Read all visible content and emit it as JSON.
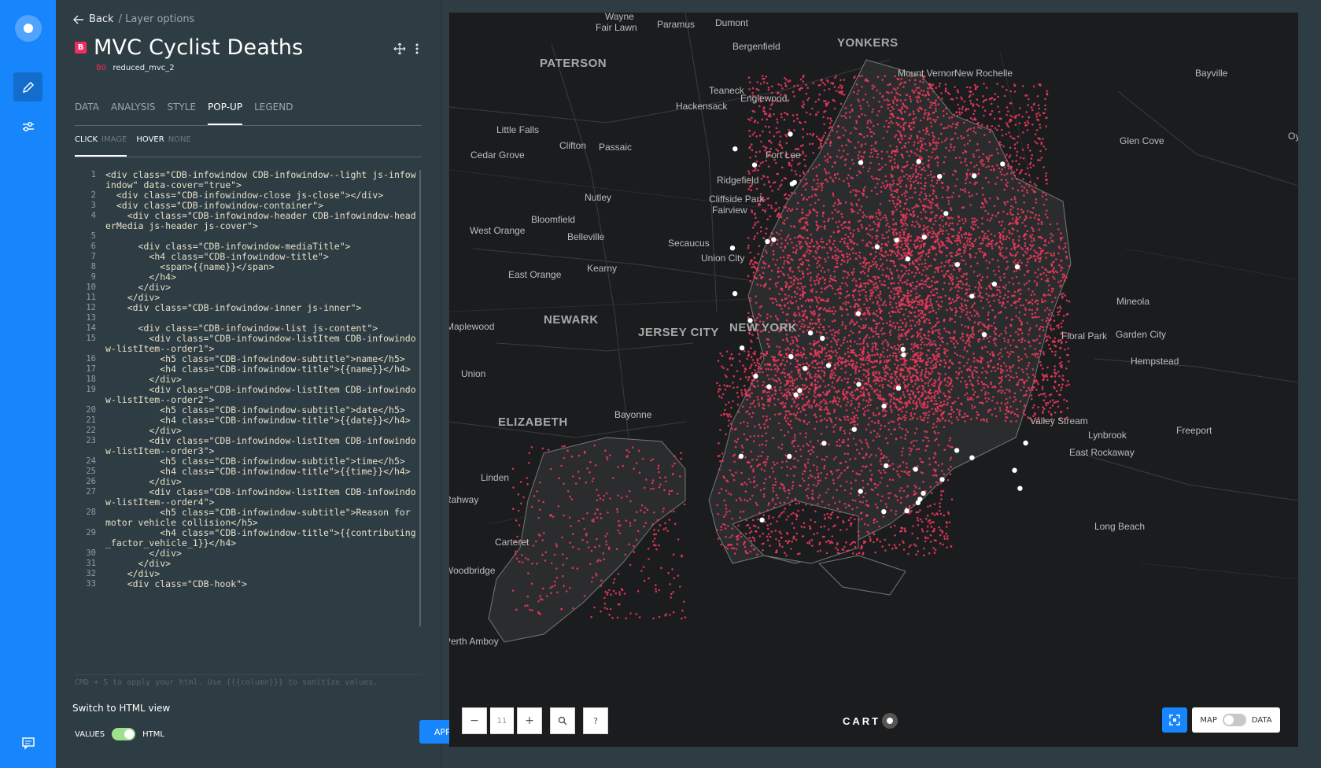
{
  "nav": {
    "icons": [
      "carto-logo-icon",
      "pencil-icon",
      "sliders-icon",
      "chat-icon"
    ]
  },
  "header": {
    "back_label": "Back",
    "crumb": "/ Layer options",
    "layer_badge": "B",
    "layer_title": "MVC Cyclist Deaths",
    "source_badge": "B0",
    "source_name": "reduced_mvc_2"
  },
  "tabs": [
    {
      "label": "DATA"
    },
    {
      "label": "ANALYSIS"
    },
    {
      "label": "STYLE"
    },
    {
      "label": "POP-UP",
      "active": true
    },
    {
      "label": "LEGEND"
    }
  ],
  "subtabs": [
    {
      "label": "CLICK",
      "value": "IMAGE",
      "active": true
    },
    {
      "label": "HOVER",
      "value": "NONE"
    }
  ],
  "editor": {
    "lines": [
      {
        "n": "1",
        "text": "<div class=\"CDB-infowindow CDB-infowindow--light js-infowindow\" data-cover=\"true\">"
      },
      {
        "n": "2",
        "text": "  <div class=\"CDB-infowindow-close js-close\"></div>"
      },
      {
        "n": "3",
        "text": "  <div class=\"CDB-infowindow-container\">"
      },
      {
        "n": "4",
        "text": "    <div class=\"CDB-infowindow-header CDB-infowindow-headerMedia js-header js-cover\">"
      },
      {
        "n": "5",
        "text": ""
      },
      {
        "n": "6",
        "text": "      <div class=\"CDB-infowindow-mediaTitle\">"
      },
      {
        "n": "7",
        "text": "        <h4 class=\"CDB-infowindow-title\">"
      },
      {
        "n": "8",
        "text": "          <span>{{name}}</span>"
      },
      {
        "n": "9",
        "text": "        </h4>"
      },
      {
        "n": "10",
        "text": "      </div>"
      },
      {
        "n": "11",
        "text": "    </div>"
      },
      {
        "n": "12",
        "text": "    <div class=\"CDB-infowindow-inner js-inner\">"
      },
      {
        "n": "13",
        "text": ""
      },
      {
        "n": "14",
        "text": "      <div class=\"CDB-infowindow-list js-content\">"
      },
      {
        "n": "15",
        "text": "        <div class=\"CDB-infowindow-listItem CDB-infowindow-listItem--order1\">"
      },
      {
        "n": "16",
        "text": "          <h5 class=\"CDB-infowindow-subtitle\">name</h5>"
      },
      {
        "n": "17",
        "text": "          <h4 class=\"CDB-infowindow-title\">{{name}}</h4>"
      },
      {
        "n": "18",
        "text": "        </div>"
      },
      {
        "n": "19",
        "text": "        <div class=\"CDB-infowindow-listItem CDB-infowindow-listItem--order2\">"
      },
      {
        "n": "20",
        "text": "          <h5 class=\"CDB-infowindow-subtitle\">date</h5>"
      },
      {
        "n": "21",
        "text": "          <h4 class=\"CDB-infowindow-title\">{{date}}</h4>"
      },
      {
        "n": "22",
        "text": "        </div>"
      },
      {
        "n": "23",
        "text": "        <div class=\"CDB-infowindow-listItem CDB-infowindow-listItem--order3\">"
      },
      {
        "n": "24",
        "text": "          <h5 class=\"CDB-infowindow-subtitle\">time</h5>"
      },
      {
        "n": "25",
        "text": "          <h4 class=\"CDB-infowindow-title\">{{time}}</h4>"
      },
      {
        "n": "26",
        "text": "        </div>"
      },
      {
        "n": "27",
        "text": "        <div class=\"CDB-infowindow-listItem CDB-infowindow-listItem--order4\">"
      },
      {
        "n": "28",
        "text": "          <h5 class=\"CDB-infowindow-subtitle\">Reason for motor vehicle collision</h5>"
      },
      {
        "n": "29",
        "text": "          <h4 class=\"CDB-infowindow-title\">{{contributing_factor_vehicle_1}}</h4>"
      },
      {
        "n": "30",
        "text": "        </div>"
      },
      {
        "n": "31",
        "text": "      </div>"
      },
      {
        "n": "32",
        "text": "    </div>"
      },
      {
        "n": "33",
        "text": "    <div class=\"CDB-hook\">"
      }
    ],
    "hint": "CMD + S to apply your html. Use {{{column}}} to sanitize values."
  },
  "footer": {
    "switch_label": "Switch to HTML view",
    "values_label": "VALUES",
    "html_label": "HTML",
    "apply_label": "APPLY"
  },
  "map": {
    "labels": [
      {
        "text": "Wayne"
      },
      {
        "text": "Fair Lawn"
      },
      {
        "text": "Paramus"
      },
      {
        "text": "Dumont"
      },
      {
        "text": "Bergenfield"
      },
      {
        "text": "YONKERS"
      },
      {
        "text": "Mount Vernon"
      },
      {
        "text": "New Rochelle"
      },
      {
        "text": "Bayville"
      },
      {
        "text": "PATERSON"
      },
      {
        "text": "Teaneck"
      },
      {
        "text": "Englewood"
      },
      {
        "text": "Hackensack"
      },
      {
        "text": "Little Falls"
      },
      {
        "text": "Clifton"
      },
      {
        "text": "Passaic"
      },
      {
        "text": "Cedar Grove"
      },
      {
        "text": "Fort Lee"
      },
      {
        "text": "Glen Cove"
      },
      {
        "text": "Ridgefield"
      },
      {
        "text": "Nutley"
      },
      {
        "text": "Cliffside Park"
      },
      {
        "text": "Fairview"
      },
      {
        "text": "Bloomfield"
      },
      {
        "text": "West Orange"
      },
      {
        "text": "Belleville"
      },
      {
        "text": "Secaucus"
      },
      {
        "text": "Union City"
      },
      {
        "text": "East Orange"
      },
      {
        "text": "Kearny"
      },
      {
        "text": "Mineola"
      },
      {
        "text": "NEWARK"
      },
      {
        "text": "JERSEY CITY"
      },
      {
        "text": "NEW YORK"
      },
      {
        "text": "Garden City"
      },
      {
        "text": "Floral Park"
      },
      {
        "text": "Maplewood"
      },
      {
        "text": "Hempstead"
      },
      {
        "text": "Union"
      },
      {
        "text": "ELIZABETH"
      },
      {
        "text": "Bayonne"
      },
      {
        "text": "Valley Stream"
      },
      {
        "text": "Freeport"
      },
      {
        "text": "Lynbrook"
      },
      {
        "text": "East Rockaway"
      },
      {
        "text": "Linden"
      },
      {
        "text": "Rahway"
      },
      {
        "text": "Long Beach"
      },
      {
        "text": "Carteret"
      },
      {
        "text": "Woodbridge"
      },
      {
        "text": "Perth Amboy"
      },
      {
        "text": "Oyster Bay"
      }
    ],
    "zoom_level": "11",
    "zoom_out_label": "−",
    "zoom_in_label": "+",
    "search_icon": "search-icon",
    "help_label": "?",
    "brand": "CART",
    "map_label": "MAP",
    "data_label": "DATA",
    "point_color": "#f23a5a",
    "highlight_color": "#ffffff"
  }
}
